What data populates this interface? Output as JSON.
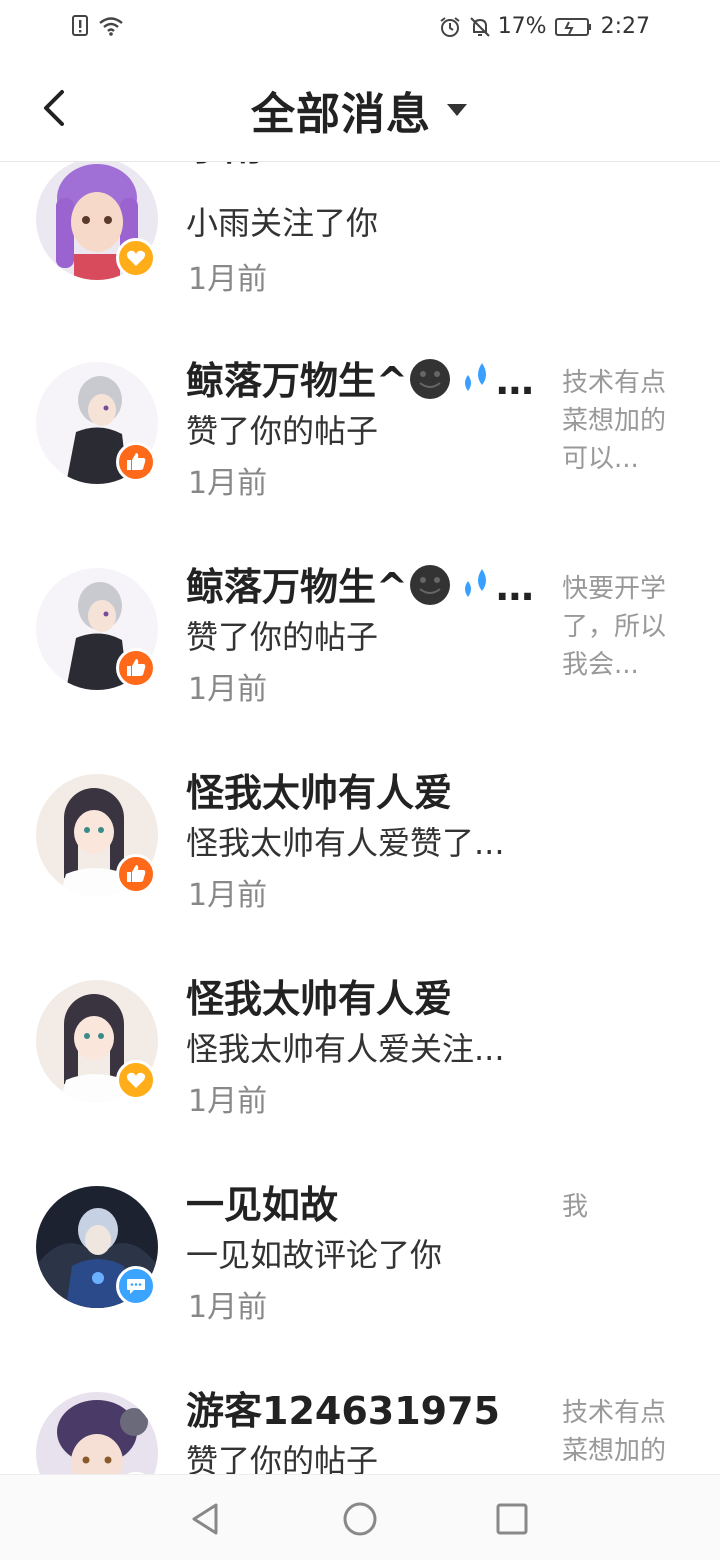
{
  "status_bar": {
    "battery": "17%",
    "time": "2:27"
  },
  "header": {
    "title": "全部消息"
  },
  "messages": [
    {
      "name": "小雨",
      "action": "小雨关注了你",
      "time": "1月前",
      "preview": "",
      "badge": "heart-icon"
    },
    {
      "name": "鲸落万物生^",
      "action": "赞了你的帖子",
      "time": "1月前",
      "preview": "技术有点菜想加的可以...",
      "badge": "thumbs-up-icon"
    },
    {
      "name": "鲸落万物生^",
      "action": "赞了你的帖子",
      "time": "1月前",
      "preview": "快要开学了，所以我会...",
      "badge": "thumbs-up-icon"
    },
    {
      "name": "怪我太帅有人爱",
      "action": "怪我太帅有人爱赞了...",
      "time": "1月前",
      "preview": "",
      "badge": "thumbs-up-icon"
    },
    {
      "name": "怪我太帅有人爱",
      "action": "怪我太帅有人爱关注...",
      "time": "1月前",
      "preview": "",
      "badge": "heart-icon"
    },
    {
      "name": "一见如故",
      "action": "一见如故评论了你",
      "time": "1月前",
      "preview": "我",
      "badge": "comment-icon"
    },
    {
      "name": "游客124631975",
      "action": "赞了你的帖子",
      "time": "",
      "preview": "技术有点菜想加的",
      "badge": "thumbs-up-icon"
    }
  ],
  "colors": {
    "follow_badge": "#ffae1a",
    "like_badge": "#ff6a1a",
    "comment_badge": "#3aa4ff"
  }
}
